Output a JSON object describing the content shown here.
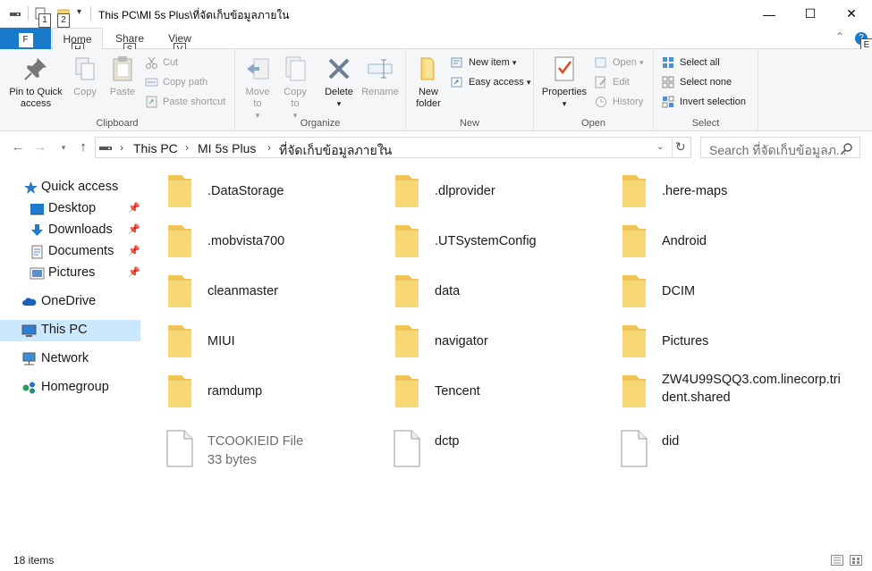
{
  "window": {
    "title": "This PC\\MI 5s Plus\\ที่จัดเก็บข้อมูลภายใน",
    "minimize": "—",
    "maximize": "☐",
    "close": "✕"
  },
  "qat": {
    "keytip1": "1",
    "keytip2": "2"
  },
  "tabs": {
    "file": "F",
    "home": "Home",
    "home_key": "H",
    "share": "Share",
    "share_key": "S",
    "view": "View",
    "view_key": "V",
    "help_key": "E"
  },
  "ribbon": {
    "clipboard": {
      "label": "Clipboard",
      "pin": "Pin to Quick access",
      "copy": "Copy",
      "paste": "Paste",
      "cut": "Cut",
      "copy_path": "Copy path",
      "paste_shortcut": "Paste shortcut"
    },
    "organize": {
      "label": "Organize",
      "move_to": "Move to",
      "copy_to": "Copy to",
      "delete": "Delete",
      "rename": "Rename"
    },
    "new": {
      "label": "New",
      "new_folder": "New folder",
      "new_item": "New item",
      "easy_access": "Easy access"
    },
    "open": {
      "label": "Open",
      "properties": "Properties",
      "open": "Open",
      "edit": "Edit",
      "history": "History"
    },
    "select": {
      "label": "Select",
      "select_all": "Select all",
      "select_none": "Select none",
      "invert_selection": "Invert selection"
    }
  },
  "address": {
    "crumbs": [
      "This PC",
      "MI 5s Plus",
      "ที่จัดเก็บข้อมูลภายใน"
    ],
    "search_placeholder": "Search ที่จัดเก็บข้อมูลภ..."
  },
  "sidebar": {
    "items": [
      {
        "label": "Quick access",
        "icon": "star-icon"
      },
      {
        "label": "Desktop",
        "icon": "desktop-icon",
        "pinned": true
      },
      {
        "label": "Downloads",
        "icon": "download-icon",
        "pinned": true
      },
      {
        "label": "Documents",
        "icon": "documents-icon",
        "pinned": true
      },
      {
        "label": "Pictures",
        "icon": "pictures-icon",
        "pinned": true
      },
      {
        "label": "OneDrive",
        "icon": "cloud-icon"
      },
      {
        "label": "This PC",
        "icon": "computer-icon",
        "selected": true
      },
      {
        "label": "Network",
        "icon": "network-icon"
      },
      {
        "label": "Homegroup",
        "icon": "homegroup-icon"
      }
    ]
  },
  "files": [
    {
      "name": ".DataStorage",
      "type": "folder"
    },
    {
      "name": ".dlprovider",
      "type": "folder"
    },
    {
      "name": ".here-maps",
      "type": "folder"
    },
    {
      "name": ".mobvista700",
      "type": "folder"
    },
    {
      "name": ".UTSystemConfig",
      "type": "folder"
    },
    {
      "name": "Android",
      "type": "folder"
    },
    {
      "name": "cleanmaster",
      "type": "folder"
    },
    {
      "name": "data",
      "type": "folder"
    },
    {
      "name": "DCIM",
      "type": "folder"
    },
    {
      "name": "MIUI",
      "type": "folder"
    },
    {
      "name": "navigator",
      "type": "folder"
    },
    {
      "name": "Pictures",
      "type": "folder"
    },
    {
      "name": "ramdump",
      "type": "folder"
    },
    {
      "name": "Tencent",
      "type": "folder"
    },
    {
      "name": "ZW4U99SQQ3.com.linecorp.trident.shared",
      "type": "folder"
    },
    {
      "name": "TCOOKIEID File",
      "type": "file",
      "detail": "33 bytes"
    },
    {
      "name": "dctp",
      "type": "file"
    },
    {
      "name": "did",
      "type": "file"
    }
  ],
  "status": {
    "item_count": "18 items"
  },
  "colors": {
    "accent": "#1979ca",
    "folder": "#f8d775",
    "selected": "#cce8ff"
  }
}
